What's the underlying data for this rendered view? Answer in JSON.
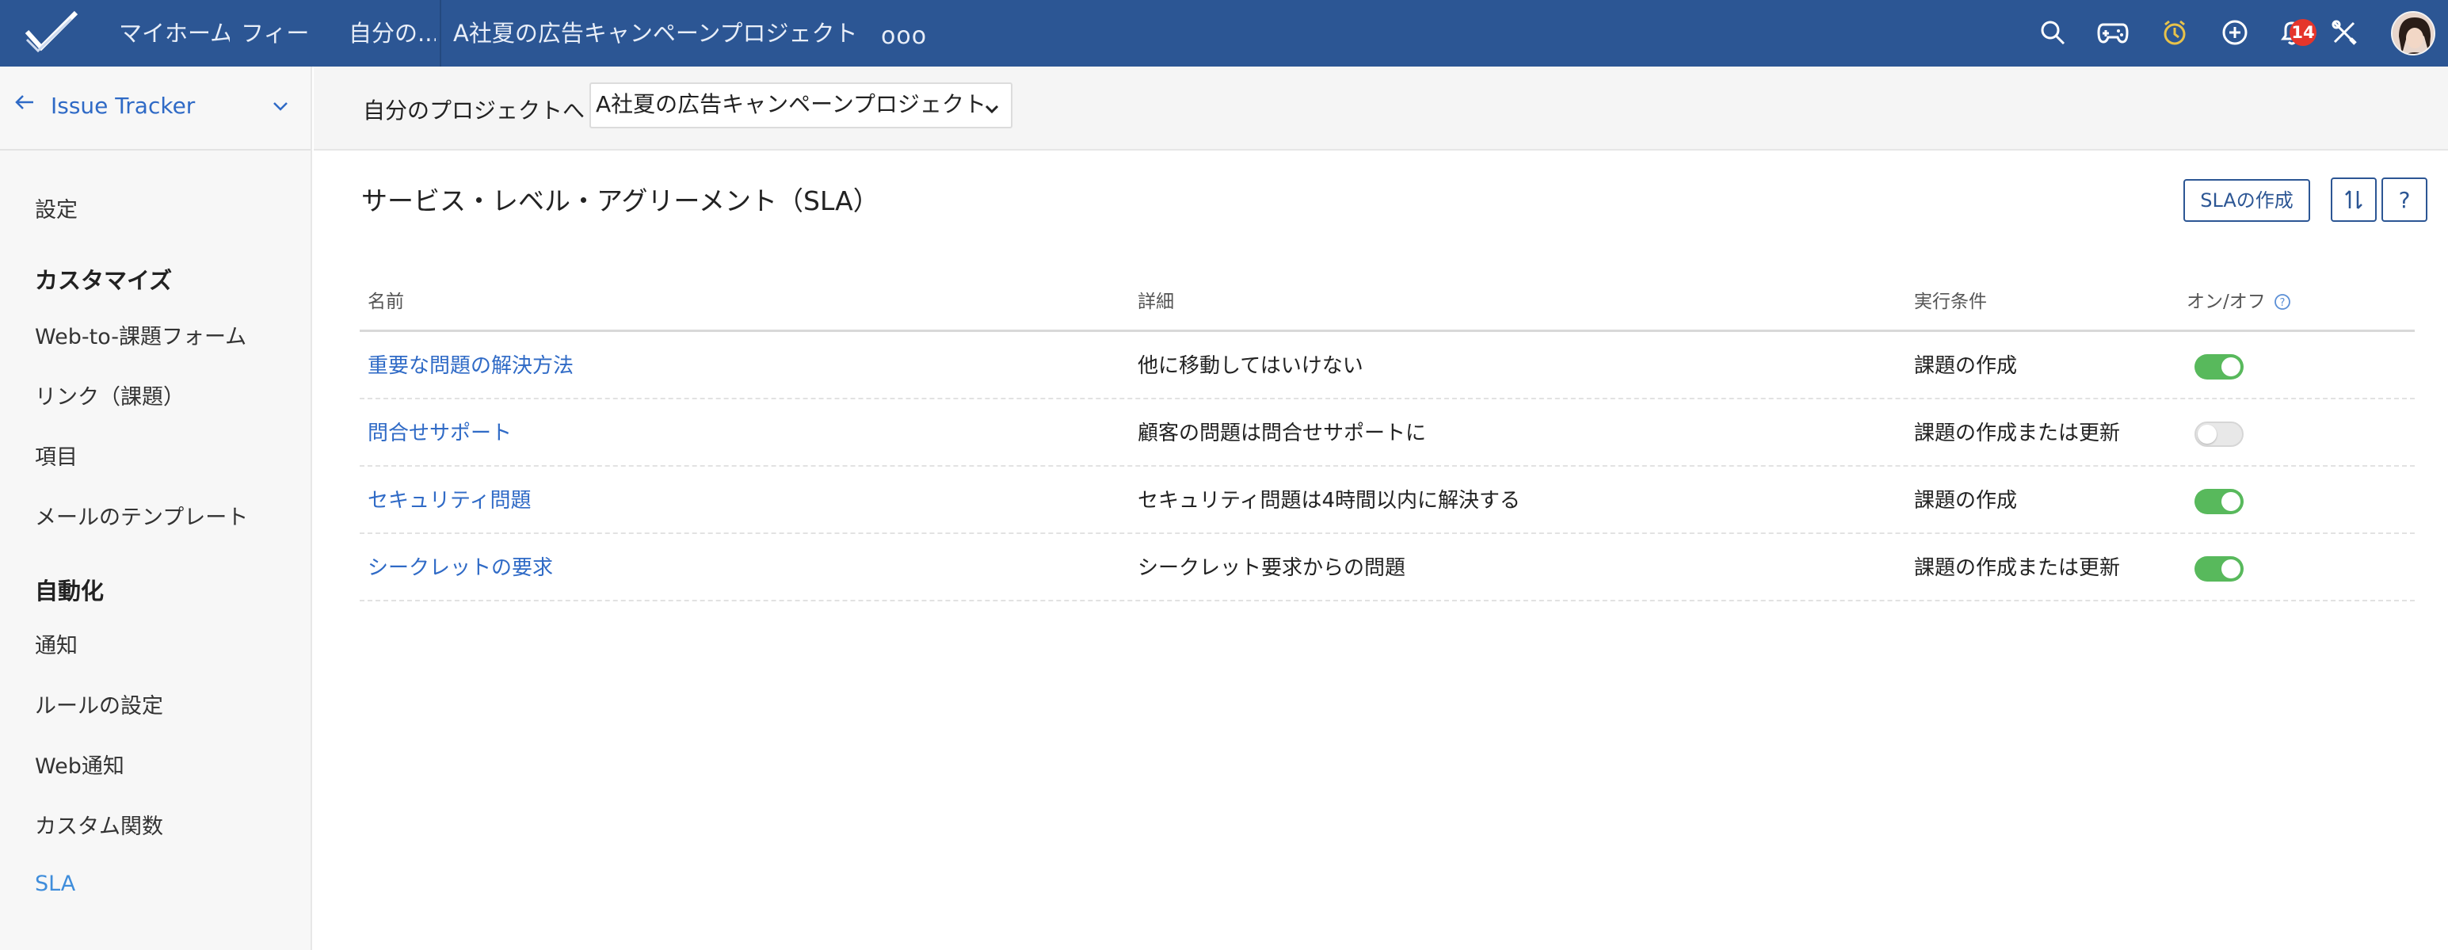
{
  "topnav": {
    "home": "マイホーム",
    "feed": "フィー",
    "my_projects": "自分の...",
    "project": "A社夏の広告キャンペーンプロジェクト",
    "more": "ooo",
    "notification_count": "14",
    "icons": [
      "check-logo",
      "search-icon",
      "gamepad-icon",
      "timer-icon",
      "add-icon",
      "bell-icon",
      "tools-icon",
      "avatar"
    ]
  },
  "sidebar": {
    "title": "Issue Tracker",
    "settings": "設定",
    "customize_header": "カスタマイズ",
    "customize_items": [
      "Web-to-課題フォーム",
      "リンク（課題）",
      "項目",
      "メールのテンプレート"
    ],
    "automation_header": "自動化",
    "automation_items": [
      "通知",
      "ルールの設定",
      "Web通知",
      "カスタム関数",
      "SLA"
    ],
    "active_item": "SLA"
  },
  "project_bar": {
    "label": "自分のプロジェクトへ",
    "selected": "A社夏の広告キャンペーンプロジェクト"
  },
  "main": {
    "title": "サービス・レベル・アグリーメント（SLA）",
    "create_button": "SLAの作成",
    "help_button": "?",
    "columns": [
      "名前",
      "詳細",
      "実行条件",
      "オン/オフ"
    ],
    "rows": [
      {
        "name": "重要な問題の解決方法",
        "detail": "他に移動してはいけない",
        "condition": "課題の作成",
        "enabled": true
      },
      {
        "name": "問合せサポート",
        "detail": "顧客の問題は問合せサポートに",
        "condition": "課題の作成または更新",
        "enabled": false
      },
      {
        "name": "セキュリティ問題",
        "detail": "セキュリティ問題は4時間以内に解決する",
        "condition": "課題の作成",
        "enabled": true
      },
      {
        "name": "シークレットの要求",
        "detail": "シークレット要求からの問題",
        "condition": "課題の作成または更新",
        "enabled": true
      }
    ]
  },
  "colors": {
    "topbar": "#2c5694",
    "link": "#2f6ac6",
    "toggle_on": "#58b95c",
    "badge": "#e5352b"
  }
}
